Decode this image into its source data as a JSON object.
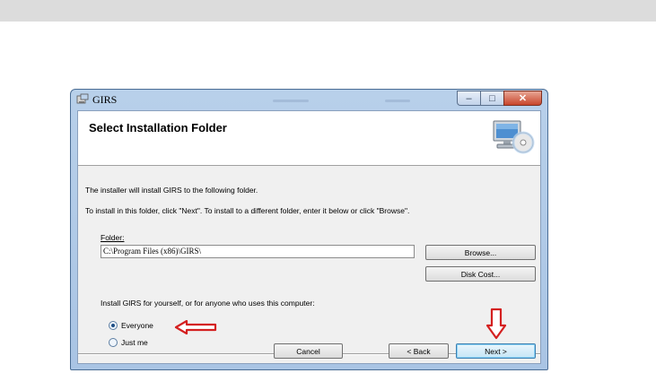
{
  "window": {
    "title": "GIRS",
    "caption": {
      "minimize": "–",
      "maximize": "□",
      "close": "✕"
    }
  },
  "banner": {
    "title": "Select Installation Folder",
    "icon": "computer-disc-icon"
  },
  "body": {
    "line1": "The installer will install GIRS to the following folder.",
    "line2": "To install in this folder, click \"Next\". To install to a different folder, enter it below or click \"Browse\".",
    "folder_label": "Folder:",
    "folder_value": "C:\\Program Files (x86)\\GIRS\\",
    "browse_label": "Browse...",
    "disk_cost_label": "Disk Cost...",
    "install_for_label": "Install GIRS for yourself, or for anyone who uses this computer:",
    "options": [
      {
        "label": "Everyone",
        "checked": true
      },
      {
        "label": "Just me",
        "checked": false
      }
    ]
  },
  "footer": {
    "cancel_label": "Cancel",
    "back_label": "< Back",
    "next_label": "Next >"
  },
  "annotations": {
    "arrow_color": "#d42020"
  }
}
